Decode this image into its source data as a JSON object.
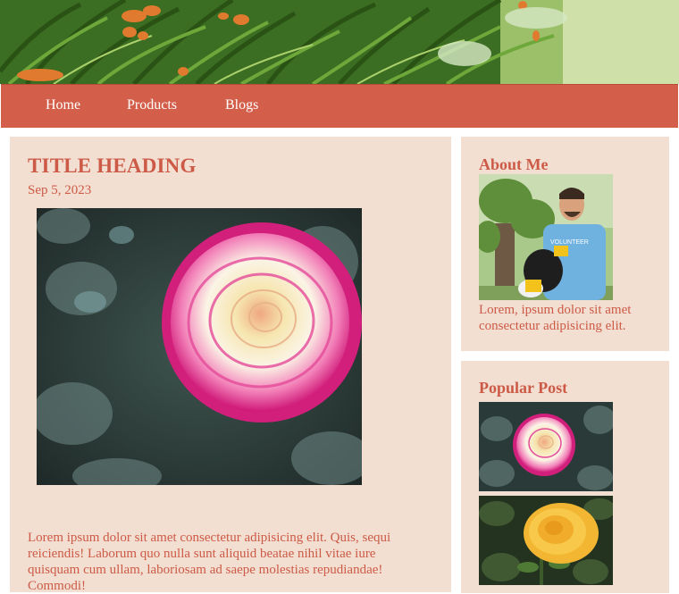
{
  "nav": {
    "items": [
      "Home",
      "Products",
      "Blogs"
    ]
  },
  "post": {
    "title": "TITLE HEADING",
    "date": "Sep 5, 2023",
    "body": "Lorem ipsum dolor sit amet consectetur adipisicing elit. Quis, sequi reiciendis! Laborum quo nulla sunt aliquid beatae nihil vitae iure quisquam cum ullam, laboriosam ad saepe molestias repudiandae! Commodi!"
  },
  "about": {
    "title": "About Me",
    "text": "Lorem, ipsum dolor sit amet consectetur adipisicing elit.",
    "shirt_text": "VOLUNTEER"
  },
  "popular": {
    "title": "Popular Post"
  },
  "colors": {
    "accent": "#d35f4b",
    "card_bg": "#f3dfd2",
    "text": "#cc5a46"
  }
}
